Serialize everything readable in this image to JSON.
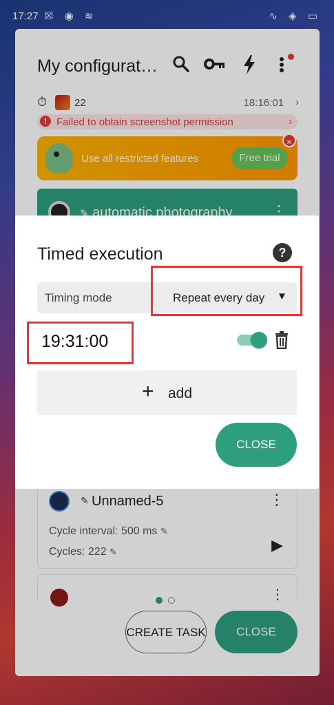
{
  "status_bar": {
    "time": "17:27",
    "left_icons": "☒ ◉ ≋",
    "right_icons": "∿ ◈ ▭"
  },
  "header": {
    "title": "My configurat…",
    "icons": [
      "search-icon",
      "key-icon",
      "lightning-icon",
      "more-vert-icon"
    ]
  },
  "info_row": {
    "count": "22",
    "time": "18:16:01"
  },
  "error": {
    "text": "Failed to obtain screenshot permission"
  },
  "promo": {
    "text": "Use all restricted features",
    "button": "Free trial"
  },
  "task_green": {
    "name": "automatic photography"
  },
  "task_card": {
    "name": "Unnamed-5",
    "interval": "Cycle interval: 500 ms",
    "cycles": "Cycles: 222"
  },
  "pager": {
    "pages": 2,
    "active": 1
  },
  "bottom": {
    "create_label": "CREATE TASK",
    "close_label": "CLOSE"
  },
  "dialog": {
    "title": "Timed execution",
    "help_glyph": "?",
    "mode_label": "Timing mode",
    "mode_value": "Repeat every day",
    "time": "19:31:00",
    "toggle_on": true,
    "add_label": "add",
    "close_label": "CLOSE"
  },
  "colors": {
    "accent": "#2e9e7e",
    "error": "#e53935",
    "highlight": "#e53935"
  }
}
